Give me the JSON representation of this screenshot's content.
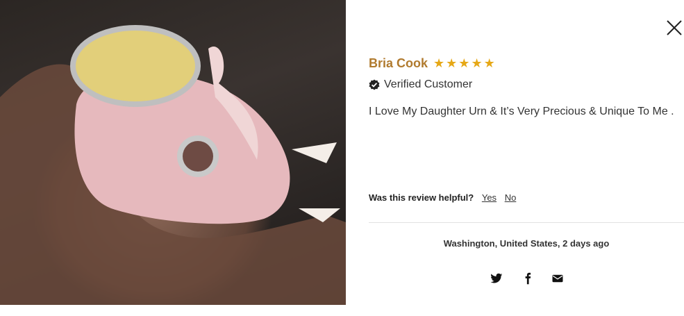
{
  "close": {
    "icon": "close-icon"
  },
  "review": {
    "author": "Bria Cook",
    "rating": 5,
    "stars_text": "★★★★★",
    "star_color": "#e6a817",
    "author_color": "#b07a2e",
    "verified_label": "Verified Customer",
    "body": "I Love My Daughter Urn & It’s Very Precious & Unique To Me ."
  },
  "helpful": {
    "question": "Was this review helpful?",
    "yes_label": "Yes",
    "no_label": "No"
  },
  "meta": {
    "location_time": "Washington, United States, 2 days ago"
  },
  "share": {
    "icons": [
      "twitter-icon",
      "facebook-icon",
      "email-icon"
    ]
  }
}
